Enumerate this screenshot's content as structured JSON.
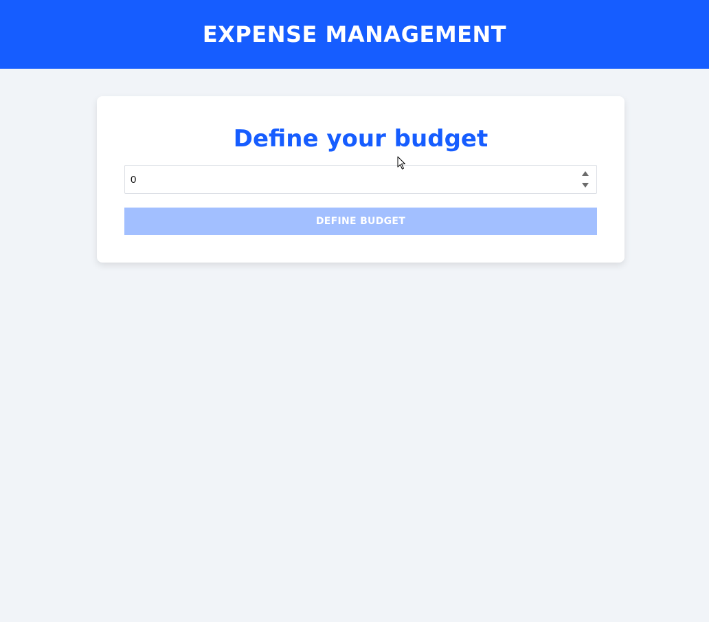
{
  "header": {
    "title": "EXPENSE MANAGEMENT"
  },
  "budget_form": {
    "heading": "Define your budget",
    "budget_value": "0",
    "submit_label": "DEFINE BUDGET"
  },
  "colors": {
    "primary": "#165dff",
    "button_disabled": "#a2bfff",
    "background": "#f1f4f8",
    "card": "#ffffff"
  },
  "icons": {
    "spinner_up": "spinner-up-icon",
    "spinner_down": "spinner-down-icon",
    "cursor": "mouse-cursor-icon"
  }
}
